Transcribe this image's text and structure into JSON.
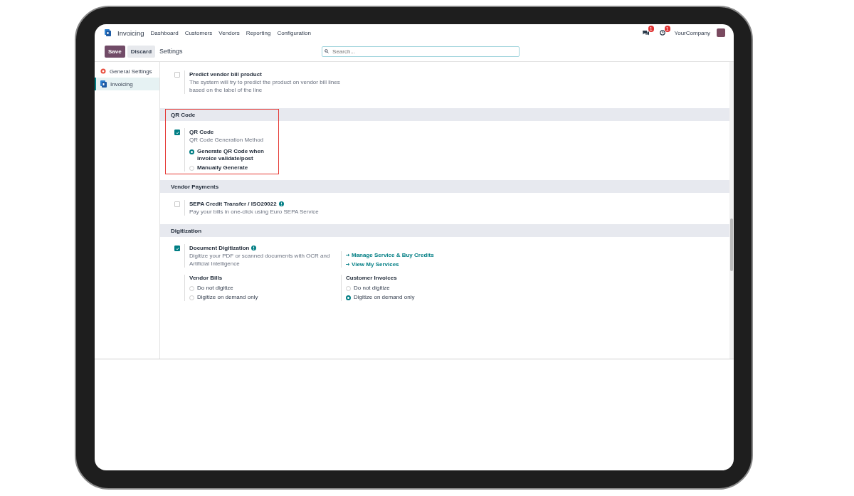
{
  "navbar": {
    "app_name": "Invoicing",
    "menu": [
      "Dashboard",
      "Customers",
      "Vendors",
      "Reporting",
      "Configuration"
    ],
    "messages_badge": "1",
    "activities_badge": "1",
    "company": "YourCompany"
  },
  "control_panel": {
    "buttons": [
      {
        "label": "Save",
        "kind": "primary"
      },
      {
        "label": "Discard",
        "kind": "secondary"
      }
    ],
    "breadcrumb": "Settings",
    "search": {
      "placeholder": "Search..."
    }
  },
  "sidebar": {
    "items": [
      {
        "label": "General Settings",
        "kind": "general",
        "selected": false
      },
      {
        "label": "Invoicing",
        "kind": "invoicing",
        "selected": true
      }
    ]
  },
  "sections": [
    {
      "settings": [
        {
          "label": "Predict vendor bill product",
          "description": "The system will try to predict the product on vendor bill lines based on the label of the line",
          "checked": false
        }
      ]
    },
    {
      "title": "QR Code",
      "highlighted": true,
      "settings": [
        {
          "label": "QR Code",
          "description": "QR Code Generation Method",
          "checked": true,
          "options": [
            {
              "label": "Generate QR Code when invoice validate/post",
              "selected": true
            },
            {
              "label": "Manually Generate",
              "selected": false
            }
          ]
        }
      ]
    },
    {
      "title": "Vendor Payments",
      "highlighted": false,
      "settings": [
        {
          "label": "SEPA Credit Transfer / ISO20022",
          "help": true,
          "description": "Pay your bills in one-click using Euro SEPA Service",
          "checked": false
        }
      ]
    },
    {
      "title": "Digitization",
      "highlighted": false,
      "settings": [
        {
          "label": "Document Digitization",
          "help": true,
          "description": "Digitize your PDF or scanned documents with OCR and Artificial Intelligence",
          "checked": true,
          "links": [
            "Manage Service & Buy Credits",
            "View My Services"
          ],
          "groups": [
            {
              "title": "Vendor Bills",
              "options": [
                {
                  "label": "Do not digitize",
                  "selected": false
                },
                {
                  "label": "Digitize on demand only",
                  "selected": false
                }
              ]
            },
            {
              "title": "Customer Invoices",
              "options": [
                {
                  "label": "Do not digitize",
                  "selected": false
                },
                {
                  "label": "Digitize on demand only",
                  "selected": true
                }
              ]
            }
          ]
        }
      ]
    }
  ]
}
